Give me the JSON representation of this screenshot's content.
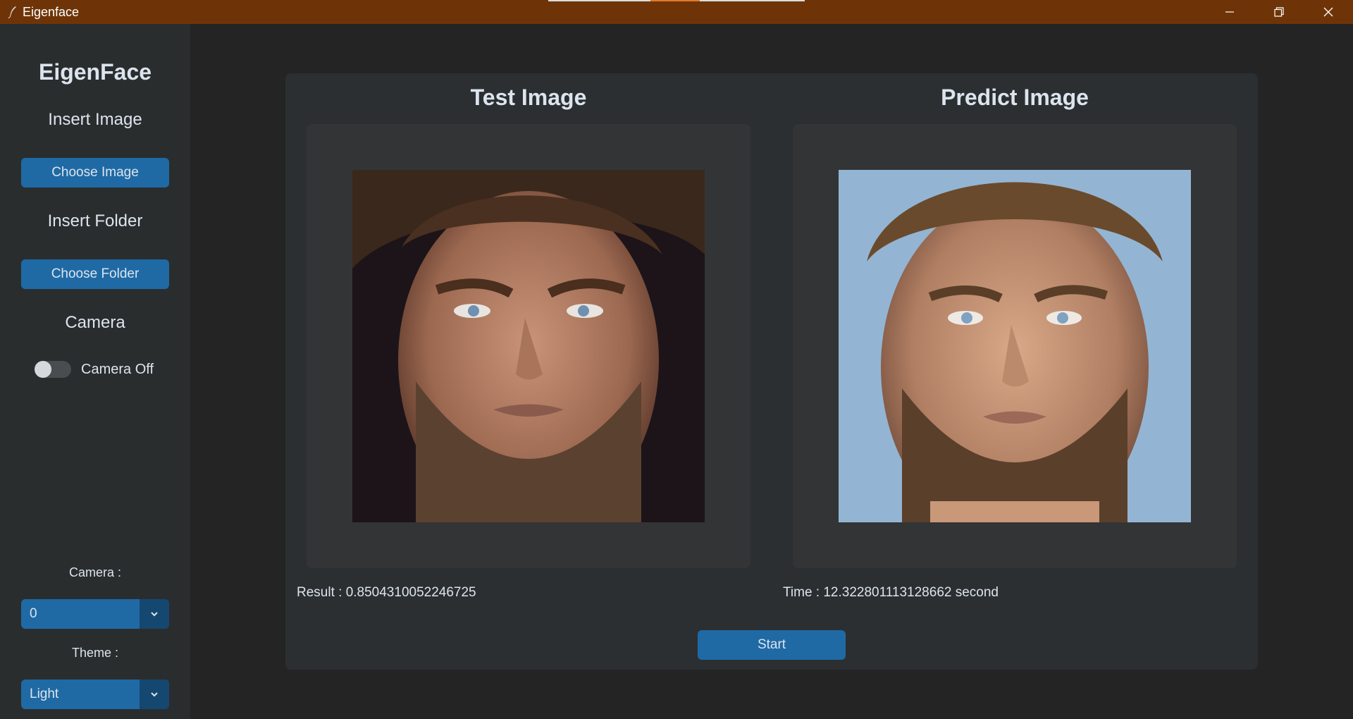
{
  "window": {
    "title": "Eigenface",
    "titlebar_color": "#6e3407",
    "controls": [
      "minimize-icon",
      "restore-icon",
      "close-icon"
    ]
  },
  "sidebar": {
    "logo": "EigenFace",
    "insert_image_label": "Insert Image",
    "choose_image_button": "Choose Image",
    "insert_folder_label": "Insert Folder",
    "choose_folder_button": "Choose Folder",
    "camera_label": "Camera",
    "camera_switch_label": "Camera Off",
    "camera_switch_on": false,
    "camera_select_label": "Camera :",
    "camera_select_value": "0",
    "theme_select_label": "Theme :",
    "theme_select_value": "Light"
  },
  "main": {
    "test_title": "Test Image",
    "predict_title": "Predict Image",
    "result_text": "Result : 0.8504310052246725",
    "time_text": "Time : 12.322801113128662 second",
    "start_button": "Start"
  },
  "colors": {
    "accent": "#1f6aa5",
    "accent_dark": "#144870",
    "sidebar_bg": "#2a2d2e",
    "frame_bg": "#2b2f32",
    "image_box_bg": "#333436"
  }
}
